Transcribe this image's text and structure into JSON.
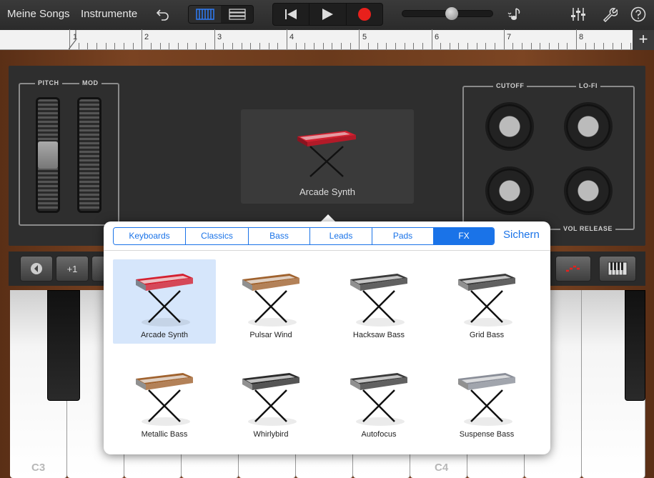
{
  "toolbar": {
    "my_songs": "Meine Songs",
    "instruments": "Instrumente"
  },
  "ruler": {
    "bars": [
      "1",
      "2",
      "3",
      "4",
      "5",
      "6",
      "7",
      "8"
    ]
  },
  "synth": {
    "pitch_label": "PITCH",
    "mod_label": "MOD",
    "cutoff_label": "CUTOFF",
    "lofi_label": "LO-FI",
    "vol_release_label": "VOL RELEASE",
    "current_patch": "Arcade Synth"
  },
  "controls": {
    "octave_up": "+1"
  },
  "keyboard": {
    "c3": "C3",
    "c4": "C4"
  },
  "popover": {
    "tabs": [
      "Keyboards",
      "Classics",
      "Bass",
      "Leads",
      "Pads",
      "FX"
    ],
    "active_tab": "FX",
    "save": "Sichern",
    "presets": [
      {
        "name": "Arcade Synth",
        "selected": true,
        "color": "#d42030"
      },
      {
        "name": "Pulsar Wind",
        "selected": false,
        "color": "#a0622e"
      },
      {
        "name": "Hacksaw Bass",
        "selected": false,
        "color": "#3a3a3a"
      },
      {
        "name": "Grid Bass",
        "selected": false,
        "color": "#3a3a3a"
      },
      {
        "name": "Metallic Bass",
        "selected": false,
        "color": "#a0622e"
      },
      {
        "name": "Whirlybird",
        "selected": false,
        "color": "#2a2a2a"
      },
      {
        "name": "Autofocus",
        "selected": false,
        "color": "#3a3a3a"
      },
      {
        "name": "Suspense Bass",
        "selected": false,
        "color": "#8a8e98"
      }
    ]
  },
  "colors": {
    "accent": "#1a73e8",
    "record": "#e8201c"
  }
}
